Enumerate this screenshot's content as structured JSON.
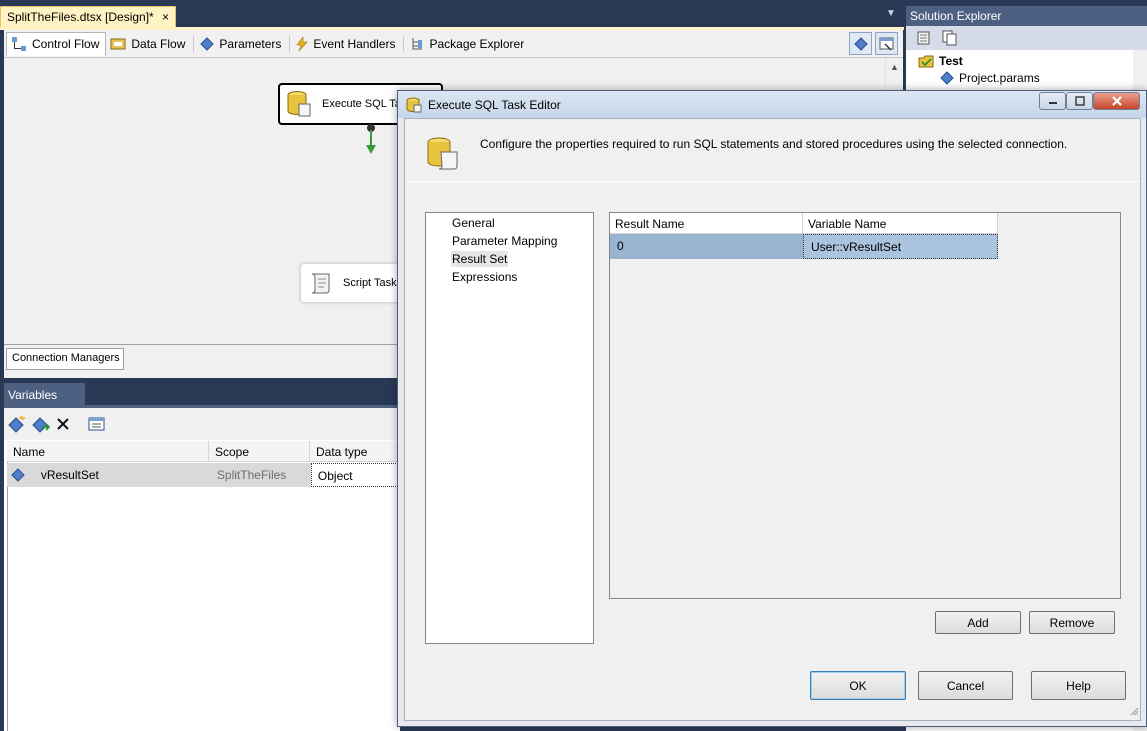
{
  "document_tab": {
    "title": "SplitTheFiles.dtsx [Design]*",
    "close": "×"
  },
  "designer_tabs": [
    {
      "label": "Control Flow",
      "icon": "control-flow-icon"
    },
    {
      "label": "Data Flow",
      "icon": "data-flow-icon"
    },
    {
      "label": "Parameters",
      "icon": "parameters-icon"
    },
    {
      "label": "Event Handlers",
      "icon": "event-handlers-icon"
    },
    {
      "label": "Package Explorer",
      "icon": "package-explorer-icon"
    }
  ],
  "canvas": {
    "execute_sql_task": "Execute SQL Task",
    "script_task": "Script Task"
  },
  "connection_managers_tab": "Connection Managers",
  "variables": {
    "title": "Variables",
    "columns": [
      "Name",
      "Scope",
      "Data type"
    ],
    "rows": [
      {
        "name": "vResultSet",
        "scope": "SplitTheFiles",
        "data_type": "Object"
      }
    ]
  },
  "solution_explorer": {
    "title": "Solution Explorer",
    "project": "Test",
    "items": [
      "Project.params"
    ]
  },
  "dialog": {
    "title": "Execute SQL Task Editor",
    "description": "Configure the properties required to run SQL statements and stored procedures using the selected connection.",
    "nav": [
      "General",
      "Parameter Mapping",
      "Result Set",
      "Expressions"
    ],
    "nav_selected": "Result Set",
    "result_set": {
      "columns": [
        "Result Name",
        "Variable Name"
      ],
      "rows": [
        {
          "result_name": "0",
          "variable_name": "User::vResultSet"
        }
      ]
    },
    "buttons": {
      "add": "Add",
      "remove": "Remove",
      "ok": "OK",
      "cancel": "Cancel",
      "help": "Help"
    }
  },
  "colors": {
    "ide_background": "#293955",
    "tool_header": "#4d6082",
    "selection": "#99b4d1",
    "doc_tab": "#fff3c4"
  }
}
